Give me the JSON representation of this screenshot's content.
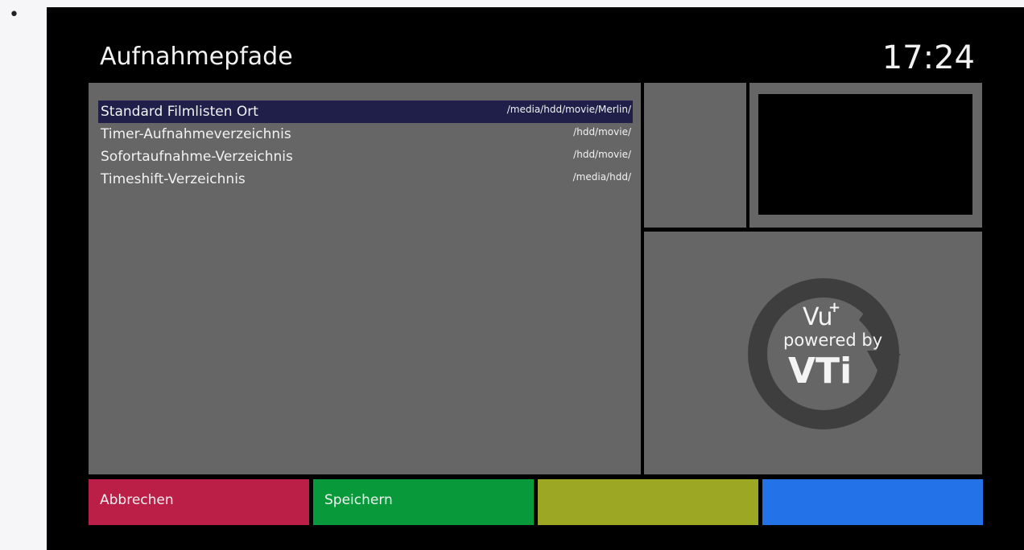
{
  "screen": {
    "title": "Aufnahmepfade",
    "clock": "17:24"
  },
  "settings": [
    {
      "label": "Standard Filmlisten Ort",
      "path": "/media/hdd/movie/Merlin/",
      "selected": true
    },
    {
      "label": "Timer-Aufnahmeverzeichnis",
      "path": "/hdd/movie/",
      "selected": false
    },
    {
      "label": "Sofortaufnahme-Verzeichnis",
      "path": "/hdd/movie/",
      "selected": false
    },
    {
      "label": "Timeshift-Verzeichnis",
      "path": "/media/hdd/",
      "selected": false
    }
  ],
  "logo": {
    "brand": "Vu",
    "superscript": "+",
    "tagline": "powered by",
    "vendor": "VTi"
  },
  "buttons": {
    "red": "Abbrechen",
    "green": "Speichern",
    "yellow": "",
    "blue": ""
  },
  "colors": {
    "selection": "#1f1f4a",
    "panel": "#666666",
    "red": "#bb1e46",
    "green": "#089a3a",
    "yellow": "#9ca823",
    "blue": "#2472e8"
  }
}
